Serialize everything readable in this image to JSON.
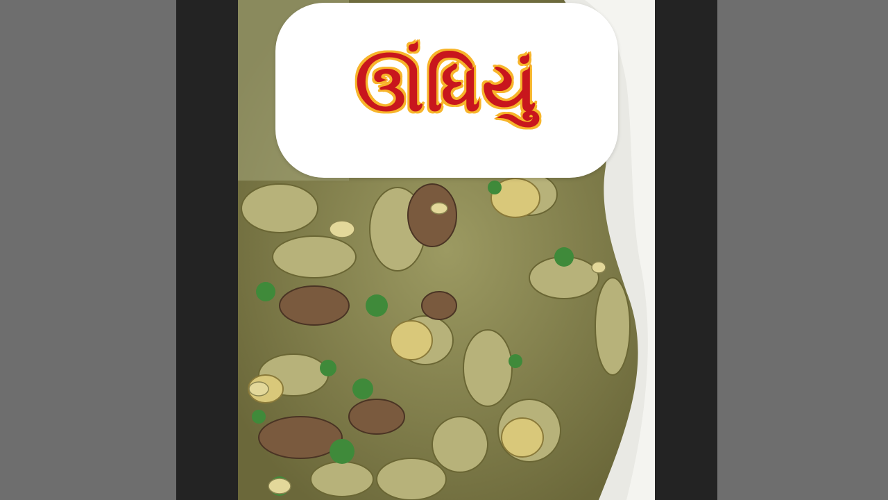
{
  "video": {
    "title_overlay": "ઊંધિયું",
    "scene": "food-photo"
  },
  "colors": {
    "title_fill": "#c8161d",
    "title_outline": "#f4a21a",
    "pill_background": "#ffffff",
    "outer_background": "#6e6e6e",
    "pillarbox": "#232323"
  }
}
